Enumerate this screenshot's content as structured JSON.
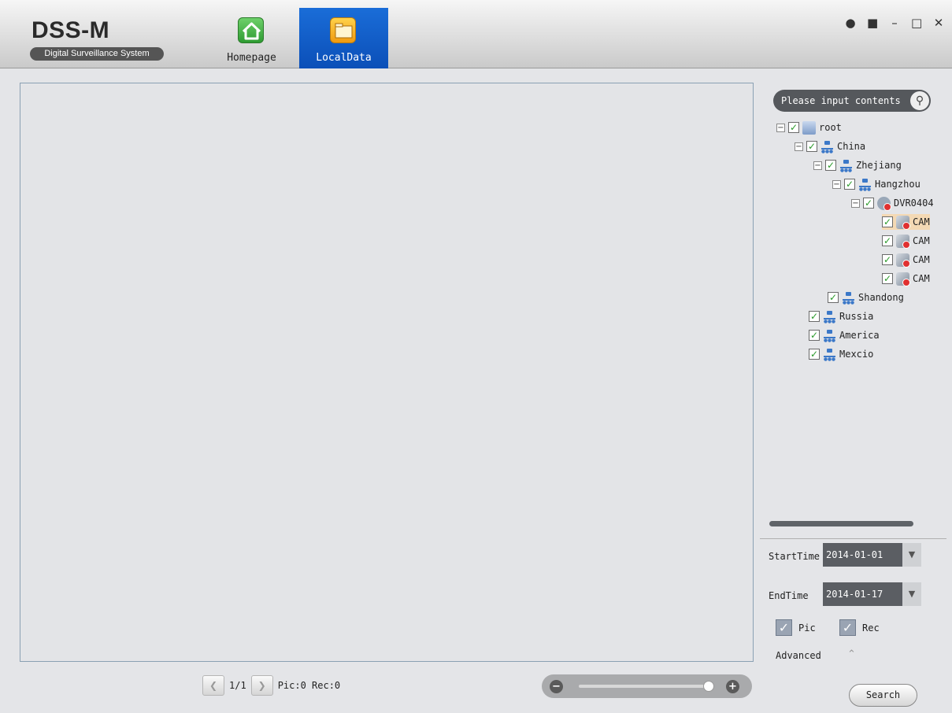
{
  "app": {
    "logo_title": "DSS-M",
    "logo_subtitle": "Digital Surveillance System"
  },
  "tabs": [
    {
      "label": "Homepage",
      "icon": "home-icon"
    },
    {
      "label": "LocalData",
      "icon": "folder-icon"
    }
  ],
  "window_controls": [
    "user-icon",
    "lock-icon",
    "minimize-icon",
    "maximize-icon",
    "close-icon"
  ],
  "pager": {
    "page": "1/1",
    "counts": "Pic:0 Rec:0"
  },
  "search": {
    "placeholder": "Please input contents"
  },
  "tree": [
    {
      "label": "root",
      "icon": "root-icon",
      "expanded": true,
      "checked": true
    },
    {
      "label": "China",
      "icon": "org-icon",
      "expanded": true,
      "checked": true
    },
    {
      "label": "Zhejiang",
      "icon": "org-icon",
      "expanded": true,
      "checked": true
    },
    {
      "label": "Hangzhou",
      "icon": "org-icon",
      "expanded": true,
      "checked": true
    },
    {
      "label": "DVR0404",
      "icon": "dvr-icon",
      "expanded": true,
      "checked": true
    },
    {
      "label": "CAM",
      "icon": "camera-icon",
      "checked": true,
      "selected": true
    },
    {
      "label": "CAM",
      "icon": "camera-icon",
      "checked": true
    },
    {
      "label": "CAM",
      "icon": "camera-icon",
      "checked": true
    },
    {
      "label": "CAM",
      "icon": "camera-icon",
      "checked": true
    },
    {
      "label": "Shandong",
      "icon": "org-icon",
      "checked": true
    },
    {
      "label": "Russia",
      "icon": "org-icon",
      "checked": true
    },
    {
      "label": "America",
      "icon": "org-icon",
      "checked": true
    },
    {
      "label": "Mexcio",
      "icon": "org-icon",
      "checked": true
    }
  ],
  "filters": {
    "start_label": "StartTime",
    "start_value": "2014-01-01",
    "end_label": "EndTime",
    "end_value": "2014-01-17",
    "pic_label": "Pic",
    "pic_checked": true,
    "rec_label": "Rec",
    "rec_checked": true,
    "advanced_label": "Advanced",
    "search_label": "Search"
  },
  "colors": {
    "accent": "#0b4fb8",
    "selection": "#f4d9b4",
    "check": "#2a9a2a"
  }
}
